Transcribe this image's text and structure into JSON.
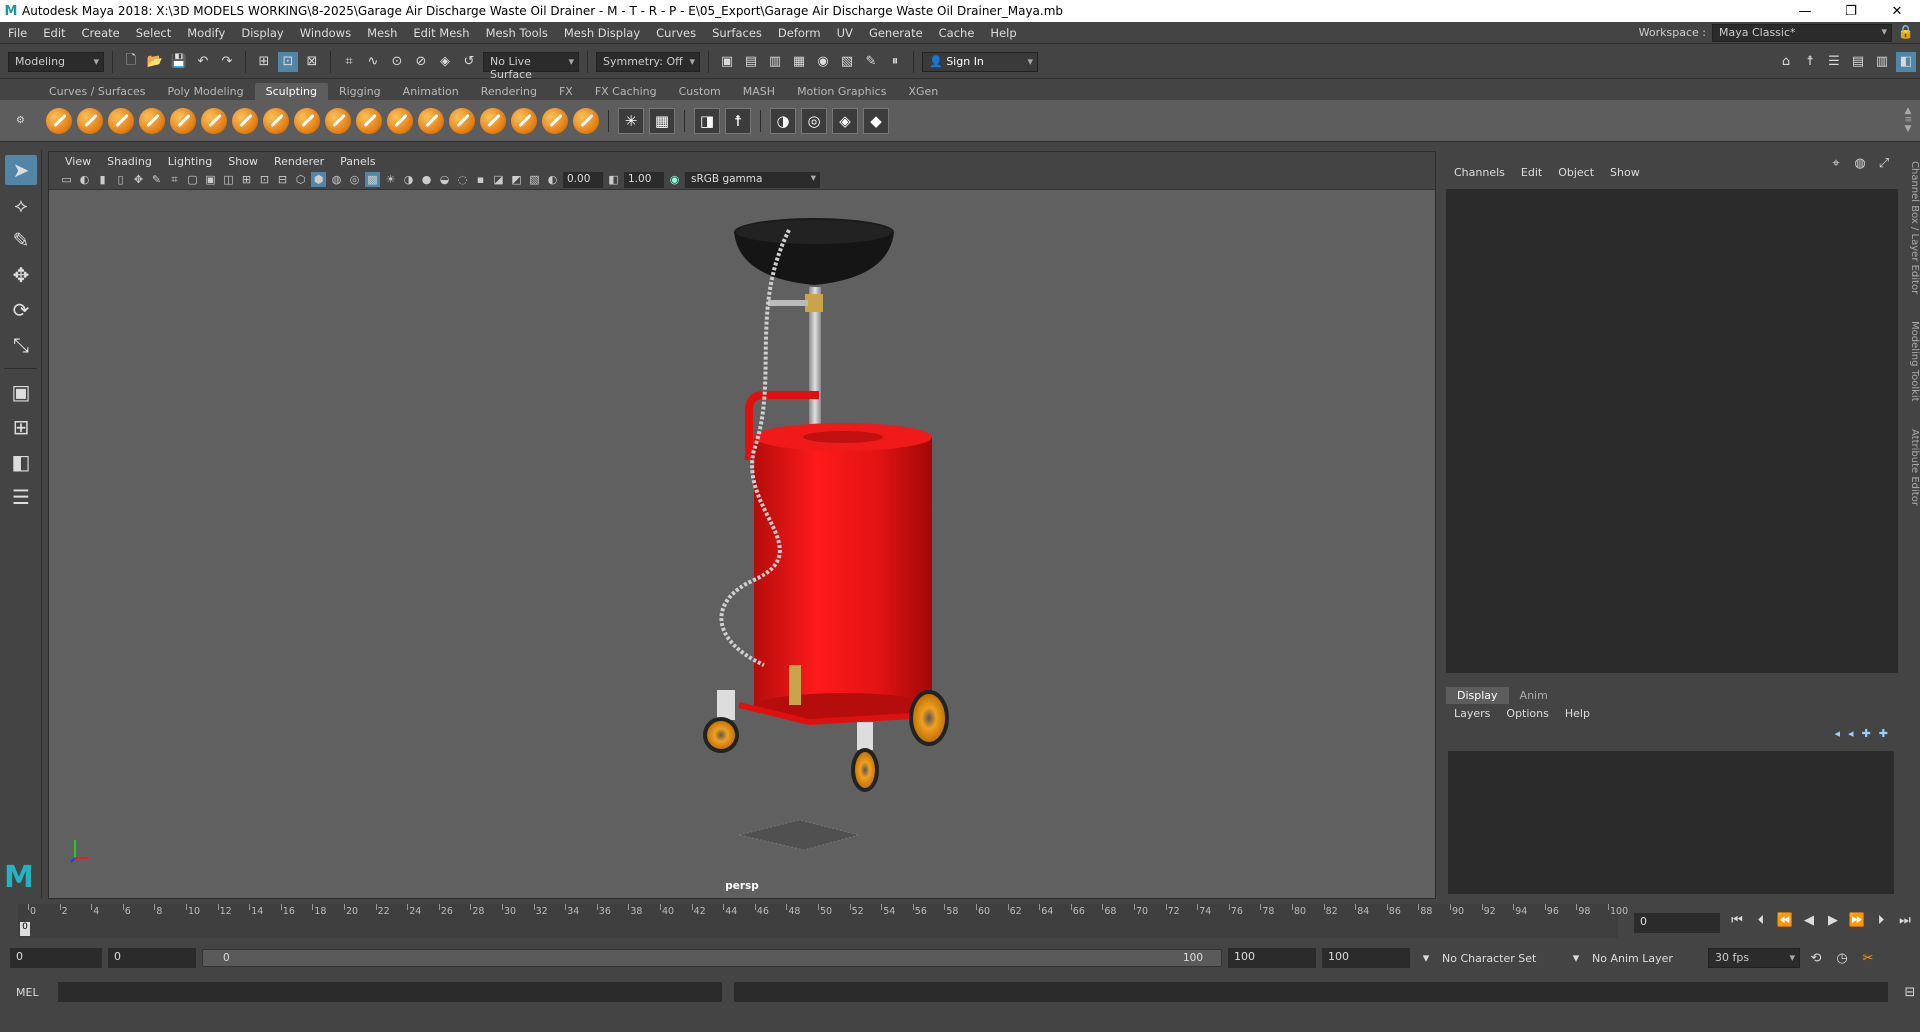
{
  "app": {
    "logo": "M",
    "title": "Autodesk Maya 2018: X:\\3D MODELS WORKING\\8-2025\\Garage Air Discharge Waste Oil Drainer - M - T - R - P - E\\05_Export\\Garage Air Discharge Waste Oil Drainer_Maya.mb",
    "minimize": "—",
    "restore": "❐",
    "close": "✕"
  },
  "menu": {
    "items": [
      "File",
      "Edit",
      "Create",
      "Select",
      "Modify",
      "Display",
      "Windows",
      "Mesh",
      "Edit Mesh",
      "Mesh Tools",
      "Mesh Display",
      "Curves",
      "Surfaces",
      "Deform",
      "UV",
      "Generate",
      "Cache",
      "Help"
    ],
    "workspace_label": "Workspace :",
    "workspace_value": "Maya Classic*"
  },
  "status": {
    "menuset": "Modeling",
    "live_surface": "No Live Surface",
    "symmetry": "Symmetry: Off",
    "sign_in": "Sign In"
  },
  "shelf_tabs": [
    "Curves / Surfaces",
    "Poly Modeling",
    "Sculpting",
    "Rigging",
    "Animation",
    "Rendering",
    "FX",
    "FX Caching",
    "Custom",
    "MASH",
    "Motion Graphics",
    "XGen"
  ],
  "viewport": {
    "menus": [
      "View",
      "Shading",
      "Lighting",
      "Show",
      "Renderer",
      "Panels"
    ],
    "exposure": "0.00",
    "gamma": "1.00",
    "color_space": "sRGB gamma",
    "camera": "persp"
  },
  "channel_box": {
    "menus": [
      "Channels",
      "Edit",
      "Object",
      "Show"
    ]
  },
  "side_tabs": [
    "Channel Box / Layer Editor",
    "Modeling Toolkit",
    "Attribute Editor"
  ],
  "layer_editor": {
    "tabs": [
      "Display",
      "Anim"
    ],
    "menus": [
      "Layers",
      "Options",
      "Help"
    ]
  },
  "timeline": {
    "labels": [
      "0",
      "2",
      "4",
      "6",
      "8",
      "10",
      "12",
      "14",
      "16",
      "18",
      "20",
      "22",
      "24",
      "26",
      "28",
      "30",
      "32",
      "34",
      "36",
      "38",
      "40",
      "42",
      "44",
      "46",
      "48",
      "50",
      "52",
      "54",
      "56",
      "58",
      "60",
      "62",
      "64",
      "66",
      "68",
      "70",
      "72",
      "74",
      "76",
      "78",
      "80",
      "82",
      "84",
      "86",
      "88",
      "90",
      "92",
      "94",
      "96",
      "98",
      "100"
    ],
    "current_frame": "0",
    "current_frame_field": "0"
  },
  "range": {
    "start": "0",
    "anim_start": "0",
    "slider_start": "0",
    "slider_end": "100",
    "anim_end": "100",
    "end": "100",
    "character_set": "No Character Set",
    "anim_layer": "No Anim Layer",
    "fps": "30 fps"
  },
  "command_line": {
    "label": "MEL"
  },
  "colors": {
    "accent": "#5285a6",
    "tank_red": "#e01010",
    "wheel_orange": "#f0a020",
    "maya_logo": "#25b3c4"
  }
}
